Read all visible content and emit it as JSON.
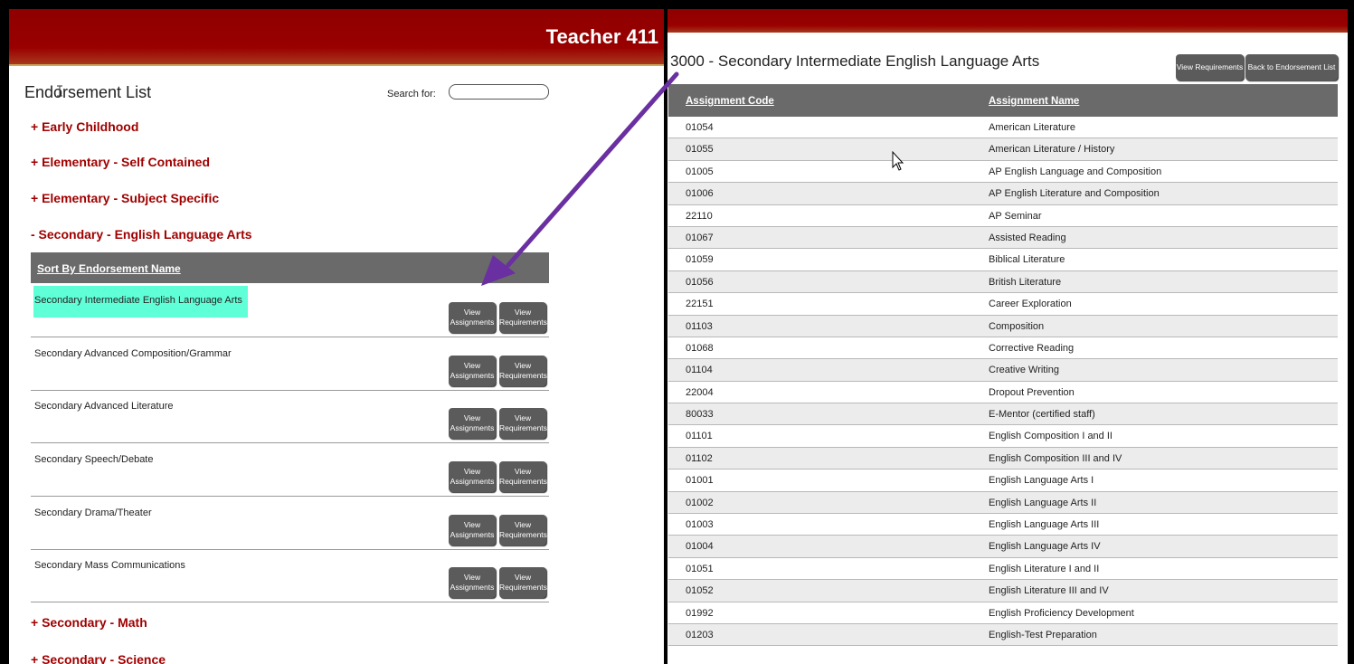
{
  "left": {
    "brand": "Teacher 411",
    "list_title": "Endorsement List",
    "search_label": "Search for:",
    "search_value": "",
    "categories_top": [
      {
        "label": "+ Early Childhood"
      },
      {
        "label": "+ Elementary - Self Contained"
      },
      {
        "label": "+ Elementary - Subject Specific"
      },
      {
        "label": "- Secondary - English Language Arts"
      }
    ],
    "sort_label": "Sort By Endorsement Name",
    "endorsements": [
      {
        "name": "Secondary Intermediate English Language Arts",
        "highlighted": true
      },
      {
        "name": "Secondary Advanced Composition/Grammar"
      },
      {
        "name": "Secondary Advanced Literature"
      },
      {
        "name": "Secondary Speech/Debate"
      },
      {
        "name": "Secondary Drama/Theater"
      },
      {
        "name": "Secondary Mass Communications"
      }
    ],
    "btn_view_assignments": [
      "View",
      "Assignments"
    ],
    "btn_view_requirements": [
      "View",
      "Requirements"
    ],
    "categories_bottom": [
      {
        "label": "+ Secondary - Math"
      },
      {
        "label": "+ Secondary - Science"
      }
    ]
  },
  "right": {
    "title": "3000 - Secondary Intermediate English Language Arts",
    "btn_view_requirements": "View Requirements",
    "btn_back": "Back to Endorsement List",
    "columns": [
      "Assignment Code",
      "Assignment Name"
    ],
    "rows": [
      [
        "01054",
        "American Literature"
      ],
      [
        "01055",
        "American Literature / History"
      ],
      [
        "01005",
        "AP English Language and Composition"
      ],
      [
        "01006",
        "AP English Literature and Composition"
      ],
      [
        "22110",
        "AP Seminar"
      ],
      [
        "01067",
        "Assisted Reading"
      ],
      [
        "01059",
        "Biblical Literature"
      ],
      [
        "01056",
        "British Literature"
      ],
      [
        "22151",
        "Career Exploration"
      ],
      [
        "01103",
        "Composition"
      ],
      [
        "01068",
        "Corrective Reading"
      ],
      [
        "01104",
        "Creative Writing"
      ],
      [
        "22004",
        "Dropout Prevention"
      ],
      [
        "80033",
        "E-Mentor (certified staff)"
      ],
      [
        "01101",
        "English Composition I and II"
      ],
      [
        "01102",
        "English Composition III and IV"
      ],
      [
        "01001",
        "English Language Arts I"
      ],
      [
        "01002",
        "English Language Arts II"
      ],
      [
        "01003",
        "English Language Arts III"
      ],
      [
        "01004",
        "English Language Arts IV"
      ],
      [
        "01051",
        "English Literature I and II"
      ],
      [
        "01052",
        "English Literature III and IV"
      ],
      [
        "01992",
        "English Proficiency Development"
      ],
      [
        "01203",
        "English-Test Preparation"
      ]
    ]
  },
  "colors": {
    "banner": "#990000",
    "category_text": "#a00000",
    "header_gray": "#6a6a6a",
    "highlight": "#5fffd8",
    "arrow": "#6a2fa0"
  }
}
